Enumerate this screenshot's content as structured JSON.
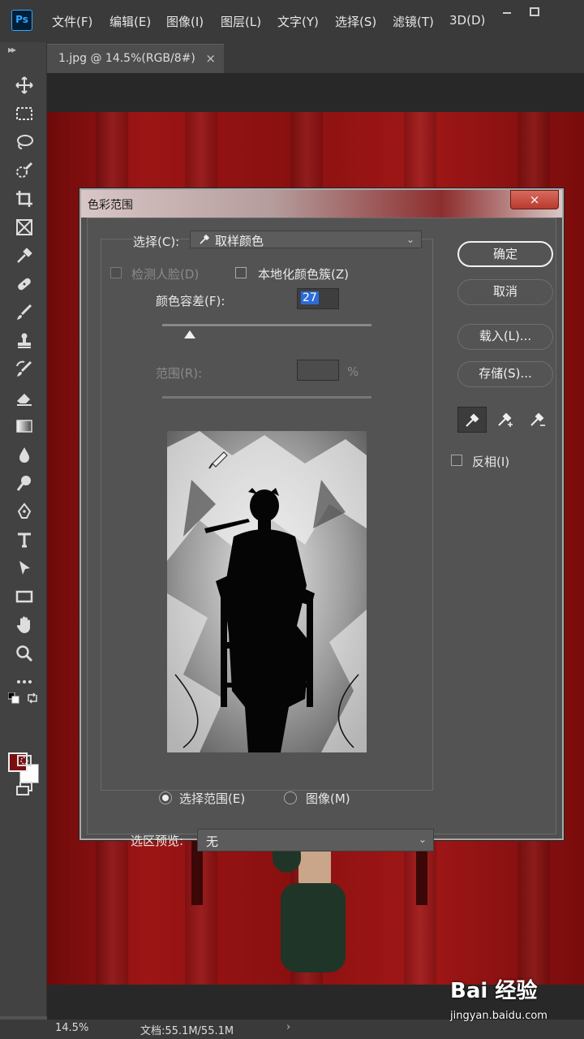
{
  "app": {
    "logo": "Ps",
    "menu": [
      "文件(F)",
      "编辑(E)",
      "图像(I)",
      "图层(L)",
      "文字(Y)",
      "选择(S)",
      "滤镜(T)",
      "3D(D)"
    ],
    "window_buttons": [
      "minimize-icon",
      "maximize-icon"
    ]
  },
  "document": {
    "tab_title": "1.jpg @ 14.5%(RGB/8#)",
    "tab_close": "×"
  },
  "toolbar": {
    "collapse": "▸▸",
    "tools": [
      "move-icon",
      "marquee-icon",
      "lasso-icon",
      "quick-select-icon",
      "crop-icon",
      "frame-icon",
      "eyedropper-icon",
      "healing-brush-icon",
      "brush-icon",
      "clone-stamp-icon",
      "history-brush-icon",
      "eraser-icon",
      "gradient-icon",
      "blur-icon",
      "dodge-icon",
      "pen-icon",
      "type-icon",
      "path-select-icon",
      "rectangle-icon",
      "hand-icon",
      "zoom-icon",
      "more-tools-icon"
    ],
    "foreground_color": "#7a0f0f",
    "background_color": "#ffffff"
  },
  "dialog": {
    "title": "色彩范围",
    "close": "×",
    "select_label": "选择(C):",
    "select_value": "取样颜色",
    "detect_faces_label": "检测人脸(D)",
    "detect_faces_checked": false,
    "detect_faces_enabled": false,
    "localized_label": "本地化颜色簇(Z)",
    "localized_checked": false,
    "fuzziness_label": "颜色容差(F):",
    "fuzziness_value": "27",
    "fuzziness_level": 0.13,
    "range_label": "范围(R):",
    "range_value": "",
    "range_unit": "%",
    "range_enabled": false,
    "radio_selection_label": "选择范围(E)",
    "radio_image_label": "图像(M)",
    "radio_selected": "selection",
    "preview_label": "选区预览:",
    "preview_value": "无",
    "buttons": {
      "ok": "确定",
      "cancel": "取消",
      "load": "载入(L)...",
      "save": "存储(S)..."
    },
    "invert_label": "反相(I)",
    "invert_checked": false
  },
  "status": {
    "zoom": "14.5%",
    "doc_info": "文档:55.1M/55.1M",
    "arrow": "›"
  },
  "watermark": {
    "logo_text": "Bai 经验",
    "url": "jingyan.baidu.com"
  }
}
